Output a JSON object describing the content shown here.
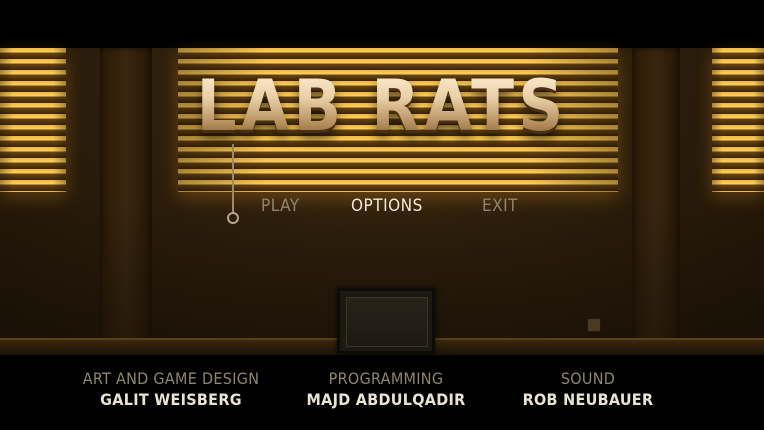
{
  "game": {
    "title": "LAB RATS"
  },
  "menu": {
    "items": [
      {
        "label": "PLAY",
        "state": "normal"
      },
      {
        "label": "OPTIONS",
        "state": "highlighted"
      },
      {
        "label": "EXIT",
        "state": "normal"
      }
    ]
  },
  "credits": [
    {
      "role": "ART AND GAME DESIGN",
      "name": "GALIT WEISBERG"
    },
    {
      "role": "PROGRAMMING",
      "name": "MAJD ABDULQADIR"
    },
    {
      "role": "SOUND",
      "name": "ROB NEUBAUER"
    }
  ],
  "colors": {
    "window_light": "#ffd25a",
    "menu_normal": "#8f8670",
    "menu_highlight": "#f2ead8",
    "credit_name": "#e9e3d3"
  }
}
